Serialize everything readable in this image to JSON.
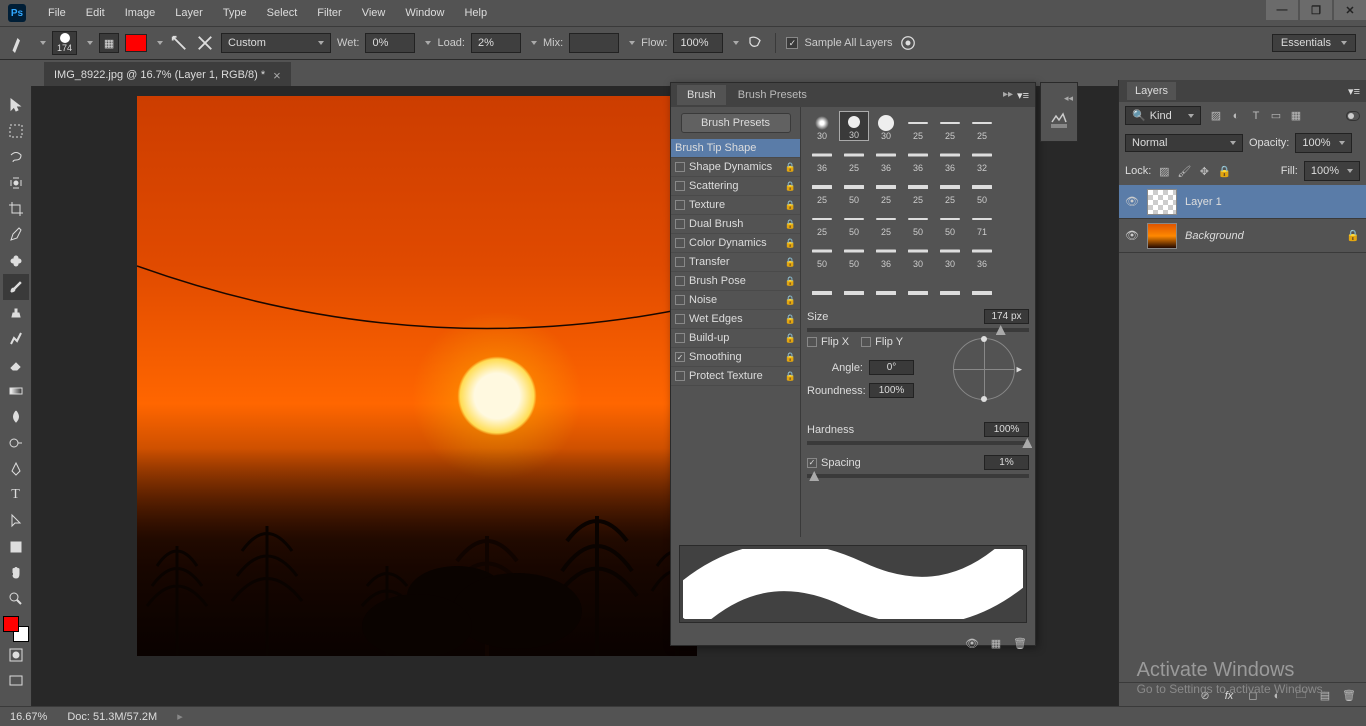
{
  "menu": [
    "File",
    "Edit",
    "Image",
    "Layer",
    "Type",
    "Select",
    "Filter",
    "View",
    "Window",
    "Help"
  ],
  "doc_tab": "IMG_8922.jpg @ 16.7% (Layer 1, RGB/8) *",
  "options": {
    "brush_size": "174",
    "preset": "Custom",
    "wet_label": "Wet:",
    "wet": "0%",
    "load_label": "Load:",
    "load": "2%",
    "mix_label": "Mix:",
    "mix": "",
    "flow_label": "Flow:",
    "flow": "100%",
    "sample_all": "Sample All Layers",
    "essentials": "Essentials"
  },
  "brush_panel": {
    "tabs": [
      "Brush",
      "Brush Presets"
    ],
    "presets_btn": "Brush Presets",
    "sections": [
      {
        "label": "Brush Tip Shape",
        "selected": true,
        "nochk": true
      },
      {
        "label": "Shape Dynamics",
        "lock": true
      },
      {
        "label": "Scattering",
        "lock": true
      },
      {
        "label": "Texture",
        "lock": true
      },
      {
        "label": "Dual Brush",
        "disabled": true,
        "lock": true
      },
      {
        "label": "Color Dynamics",
        "disabled": true,
        "lock": true
      },
      {
        "label": "Transfer",
        "lock": true
      },
      {
        "label": "Brush Pose",
        "lock": true
      },
      {
        "label": "Noise",
        "disabled": true,
        "lock": true
      },
      {
        "label": "Wet Edges",
        "disabled": true,
        "lock": true
      },
      {
        "label": "Build-up",
        "lock": true
      },
      {
        "label": "Smoothing",
        "checked": true,
        "lock": true
      },
      {
        "label": "Protect Texture",
        "lock": true
      }
    ],
    "brush_sizes_rows": [
      [
        "30",
        "30",
        "30",
        "25",
        "25",
        "25"
      ],
      [
        "36",
        "25",
        "36",
        "36",
        "36",
        "32"
      ],
      [
        "25",
        "50",
        "25",
        "25",
        "25",
        "50"
      ],
      [
        "25",
        "50",
        "25",
        "50",
        "50",
        "71"
      ],
      [
        "50",
        "50",
        "36",
        "30",
        "30",
        "36"
      ],
      [
        "",
        "",
        "",
        "",
        "",
        ""
      ]
    ],
    "size_label": "Size",
    "size": "174 px",
    "flipx": "Flip X",
    "flipy": "Flip Y",
    "angle_label": "Angle:",
    "angle": "0°",
    "round_label": "Roundness:",
    "round": "100%",
    "hard_label": "Hardness",
    "hard": "100%",
    "spacing_label": "Spacing",
    "spacing": "1%"
  },
  "layers": {
    "title": "Layers",
    "kind": "Kind",
    "blend": "Normal",
    "opacity_label": "Opacity:",
    "opacity": "100%",
    "lock_label": "Lock:",
    "fill_label": "Fill:",
    "fill": "100%",
    "items": [
      {
        "name": "Layer 1",
        "thumb": "checker",
        "selected": true
      },
      {
        "name": "Background",
        "thumb": "sunset",
        "italic": true,
        "locked": true
      }
    ]
  },
  "status": {
    "zoom": "16.67%",
    "doc": "Doc: 51.3M/57.2M"
  },
  "watermark": {
    "t1": "Activate Windows",
    "t2": "Go to Settings to activate Windows."
  }
}
